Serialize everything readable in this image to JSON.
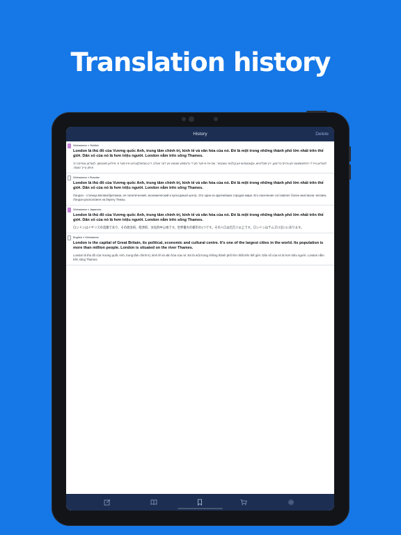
{
  "headline": "Translation history",
  "nav": {
    "title": "History",
    "delete_label": "Delete"
  },
  "entries": [
    {
      "lang_pair": "Vietnamese ● Yiddish",
      "bookmarked": true,
      "source": "London là thủ đô của Vương quốc Anh, trung tâm chính trị, kinh tế và văn hóa của nó. Đó là một trong những thành phố lớn nhất trên thế giới. Dân số của nó là hơn triệu người. London nằm trên sông Thames.",
      "translation": "לאָנדאָן איז די הויפּטשטאָט פון גרויס בריטאַן, זיין פּאָליטיש, עקאָנאָמיש און קולטור צענטער. עס איז איינער פון די גרעסטע שטעט אין דער וועלט. זיין באַפעלקערונג איז מער ווי מיליאָן מענטשן. לאָנדאָן געפינט זיך אויפן טייך טעמז."
    },
    {
      "lang_pair": "Vietnamese ● Russian",
      "bookmarked": false,
      "source": "London là thủ đô của Vương quốc Anh, trung tâm chính trị, kinh tế và văn hóa của nó. Đó là một trong những thành phố lớn nhất trên thế giới. Dân số của nó là hơn triệu người. London nằm trên sông Thames.",
      "translation": "Лондон - столица Великобритании, ее политический, экономический и культурный центр. Это один из крупнейших городов мира. Его население составляет более миллиона человек. Лондон расположен на берегу Темзы."
    },
    {
      "lang_pair": "Vietnamese ● Japanese",
      "bookmarked": true,
      "source": "London là thủ đô của Vương quốc Anh, trung tâm chính trị, kinh tế và văn hóa của nó. Đó là một trong những thành phố lớn nhất trên thế giới. Dân số của nó là hơn triệu người. London nằm trên sông Thames.",
      "translation": "ロンドンはイギリスの首都であり、その政治的、経済的、文化的中心地です。世界最大の都市の1つです。その人口は百万人以上です。ロンドンはテムズ川沿いにあります。"
    },
    {
      "lang_pair": "English ● Vietnamese",
      "bookmarked": false,
      "source": "London is the capital of Great Britain, its political, economic and cultural centre. It's one of the largest cities in the world. Its population is more than million people. London is situated on the river Thames.",
      "translation": "London là thủ đô của Vương quốc Anh, trung tâm chính trị, kinh tế và văn hóa của nó. Đó là một trong những thành phố lớn nhất trên thế giới. Dân số của nó là hơn triệu người. London nằm trên sông Thames."
    }
  ],
  "tabs": [
    {
      "icon": "edit-icon"
    },
    {
      "icon": "book-icon"
    },
    {
      "icon": "bookmark-icon"
    },
    {
      "icon": "cart-icon"
    },
    {
      "icon": "gear-icon"
    }
  ],
  "colors": {
    "background": "#1677e6",
    "navbar": "#1c2e52",
    "bookmark_active": "#c586d8",
    "delete": "#8fa6d6"
  }
}
